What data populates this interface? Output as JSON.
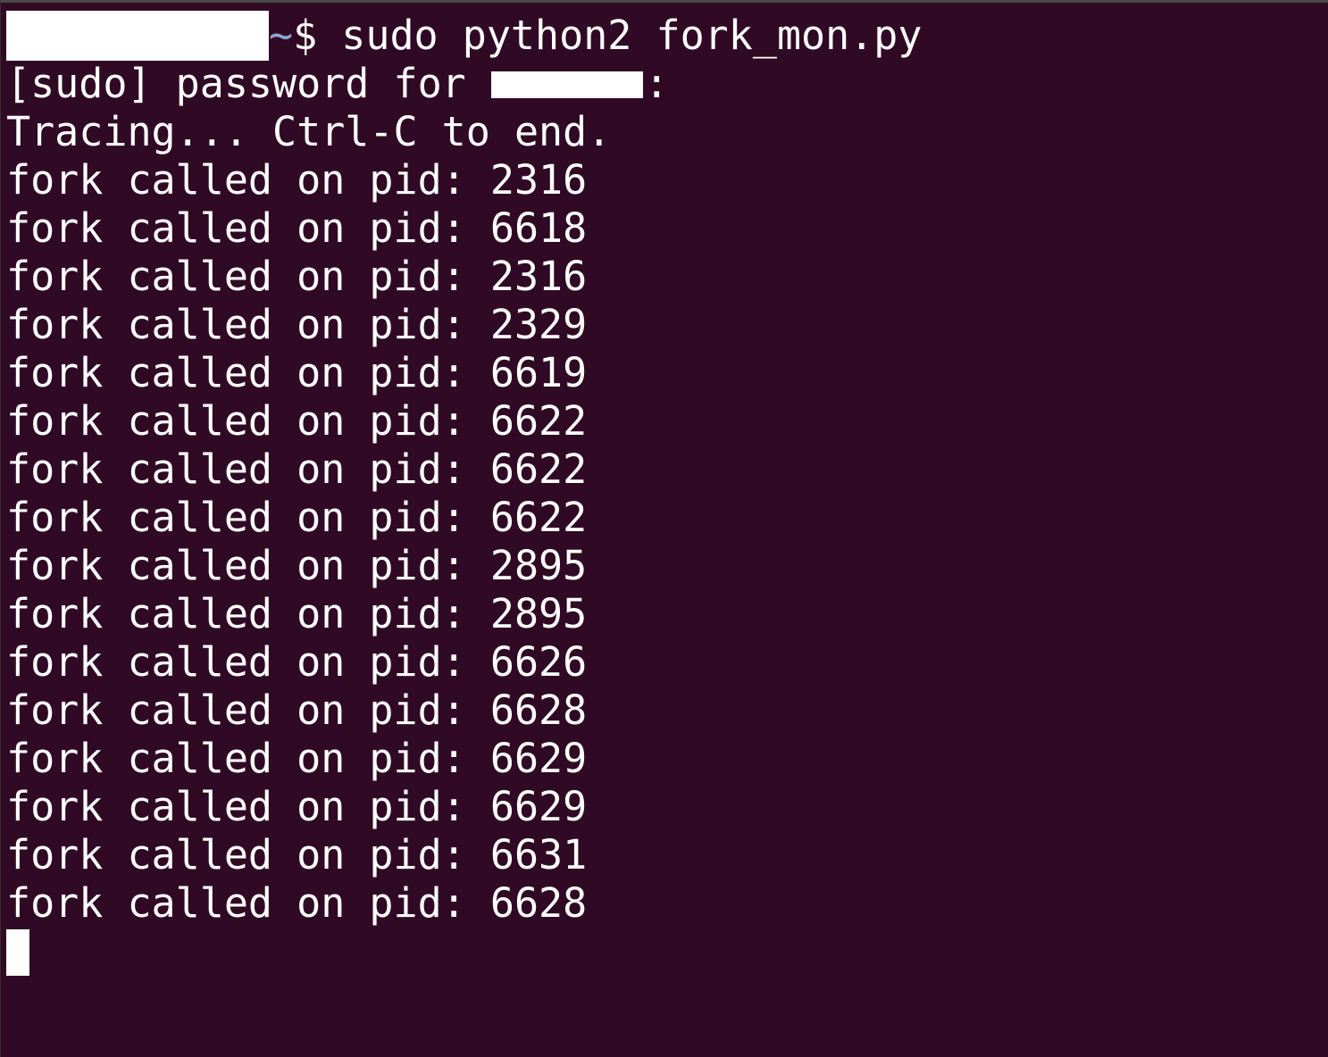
{
  "terminal": {
    "background": "#300a24",
    "foreground": "#ffffff",
    "prompt_path": "~",
    "prompt_symbol": "$",
    "command": " sudo python2 fork_mon.py",
    "sudo_prompt_prefix": "[sudo] password for",
    "sudo_prompt_suffix": ":",
    "tracing_message": "Tracing... Ctrl-C to end.",
    "output_lines": [
      "fork called on pid: 2316",
      "fork called on pid: 6618",
      "fork called on pid: 2316",
      "fork called on pid: 2329",
      "fork called on pid: 6619",
      "fork called on pid: 6622",
      "fork called on pid: 6622",
      "fork called on pid: 6622",
      "fork called on pid: 2895",
      "fork called on pid: 2895",
      "fork called on pid: 6626",
      "fork called on pid: 6628",
      "fork called on pid: 6629",
      "fork called on pid: 6629",
      "fork called on pid: 6631",
      "fork called on pid: 6628"
    ]
  }
}
